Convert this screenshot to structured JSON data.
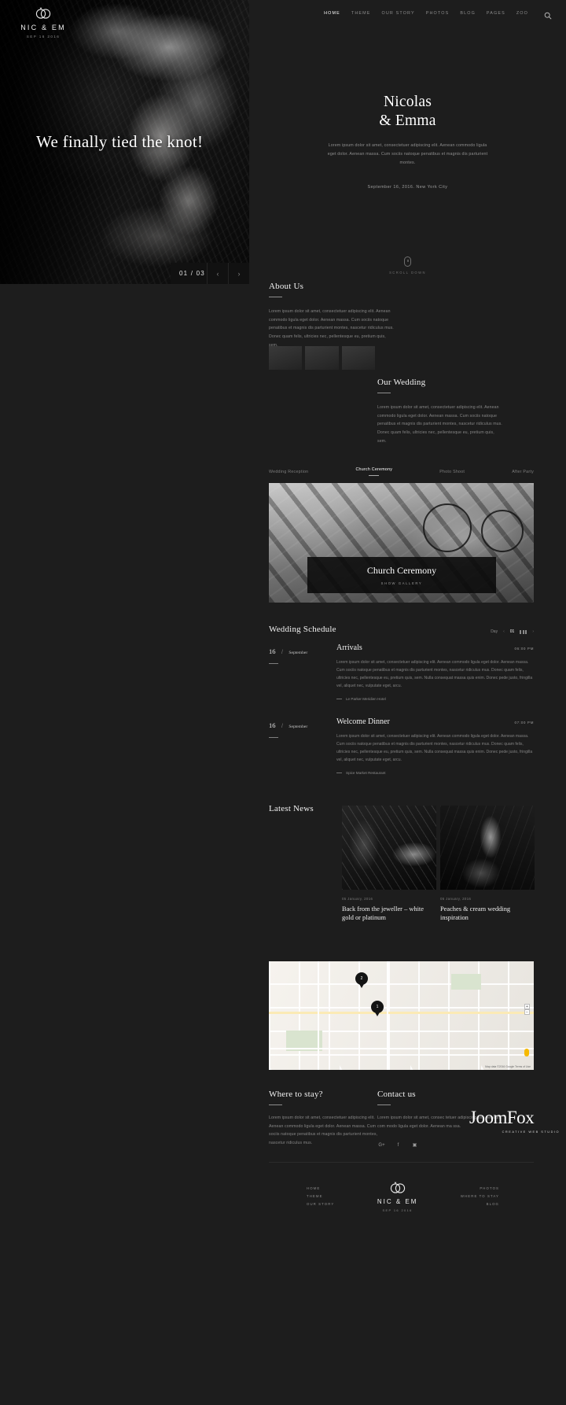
{
  "brand": {
    "name": "NIC & EM",
    "date": "SEP 16 2016"
  },
  "nav": {
    "items": [
      {
        "label": "HOME",
        "active": true
      },
      {
        "label": "THEME",
        "active": false
      },
      {
        "label": "OUR STORY",
        "active": false
      },
      {
        "label": "PHOTOS",
        "active": false
      },
      {
        "label": "BLOG",
        "active": false
      },
      {
        "label": "PAGES",
        "active": false
      },
      {
        "label": "ZOO",
        "active": false
      }
    ],
    "search_icon": "search-icon"
  },
  "hero": {
    "caption": "We finally tied the knot!",
    "counter": "01 / 03",
    "prev": "‹",
    "next": "›"
  },
  "intro": {
    "title_line1": "Nicolas",
    "title_line2": "& Emma",
    "lead": "Lorem ipsum dolor sit amet, consectetuer adipiscing elit. Aenean commodo ligula eget dolor. Aenean massa. Cum sociis natoque penatibus et magnis dis parturient montes.",
    "date": "September 16, 2016. New York City"
  },
  "scroll": {
    "label": "SCROLL DOWN",
    "icon": "mouse-icon"
  },
  "about": {
    "title": "About Us",
    "body": "Lorem ipsum dolor sit amet, consectetuer adipiscing elit. Aenean commodo ligula eget dolor. Aenean massa. Cum sociis natoque penatibus et magnis dis parturient montes, nascetur ridiculus mus. Donec quam felis, ultricies nec, pellentesque eu, pretium quis, sem."
  },
  "wedding": {
    "title": "Our Wedding",
    "body": "Lorem ipsum dolor sit amet, consectetuer adipiscing elit. Aenean commodo ligula eget dolor. Aenean massa. Cum sociis natoque penatibus et magnis dis parturient montes, nascetur ridiculus mus. Donec quam felis, ultricies nec, pellentesque eu, pretium quis, sem."
  },
  "gallery": {
    "tabs": [
      {
        "label": "Wedding Reception",
        "active": false
      },
      {
        "label": "Church Ceremony",
        "active": true
      },
      {
        "label": "Photo Shoot",
        "active": false
      },
      {
        "label": "After Party",
        "active": false
      }
    ],
    "overlay_title": "Church Ceremony",
    "overlay_cta": "SHOW GALLERY"
  },
  "schedule": {
    "title": "Wedding Schedule",
    "control": {
      "day_label": "Day",
      "prev": "‹",
      "number": "01",
      "next": "›"
    },
    "items": [
      {
        "day": "16",
        "separator": "/",
        "month": "September",
        "event": "Arrivals",
        "time": "06:00 PM",
        "desc": "Lorem ipsum dolor sit amet, consectetuer adipiscing elit. Aenean commodo ligula eget dolor. Aenean massa. Cum sociis natoque penatibus et magnis dis parturient montes, nascetur ridiculus mus. Donec quam felis, ultricies nec, pellentesque eu, pretium quis, sem. Nulla consequat massa quis enim. Donec pede justo, fringilla vel, aliquet nec, vulputate eget, arcu.",
        "location": "Le Parker Meridien Hotel"
      },
      {
        "day": "16",
        "separator": "/",
        "month": "September",
        "event": "Welcome Dinner",
        "time": "07:00 PM",
        "desc": "Lorem ipsum dolor sit amet, consectetuer adipiscing elit. Aenean commodo ligula eget dolor. Aenean massa. Cum sociis natoque penatibus et magnis dis parturient montes, nascetur ridiculus mus. Donec quam felis, ultricies nec, pellentesque eu, pretium quis, sem. Nulla consequat massa quis enim. Donec pede justo, fringilla vel, aliquet nec, vulputate eget, arcu.",
        "location": "Spice Market Restaurant"
      }
    ]
  },
  "news": {
    "title": "Latest News",
    "posts": [
      {
        "date": "05 January, 2016",
        "headline": "Back from the jeweller – white gold or platinum"
      },
      {
        "date": "05 January, 2016",
        "headline": "Peaches & cream wedding inspiration"
      }
    ]
  },
  "map": {
    "pins": [
      {
        "label": "2"
      },
      {
        "label": "1"
      }
    ],
    "credit": "Map data ©2016 Google    Terms of Use"
  },
  "stay": {
    "title": "Where to stay?",
    "body": "Lorem ipsum dolor sit amet, consectetuer adipiscing elit. Aenean commodo ligula eget dolor. Aenean massa. Cum sociis natoque penatibus et magnis dis parturient montes, nascetur ridiculus mus."
  },
  "contact": {
    "title": "Contact us",
    "body": "Lorem ipsum dolor sit amet, consec tetuer adipiscing elit. Aenean com modo ligula eget dolor. Aenean ma ssa.",
    "socials": [
      {
        "icon": "google-plus-icon",
        "glyph": "G+"
      },
      {
        "icon": "facebook-icon",
        "glyph": "f"
      },
      {
        "icon": "instagram-icon",
        "glyph": "▣"
      }
    ]
  },
  "watermark": {
    "name": "JoomFox",
    "tagline": "CREATIVE WEB STUDIO"
  },
  "footer": {
    "left_links": [
      "HOME",
      "THEME",
      "OUR STORY"
    ],
    "right_links": [
      "PHOTOS",
      "WHERE TO STAY",
      "BLOG"
    ]
  }
}
